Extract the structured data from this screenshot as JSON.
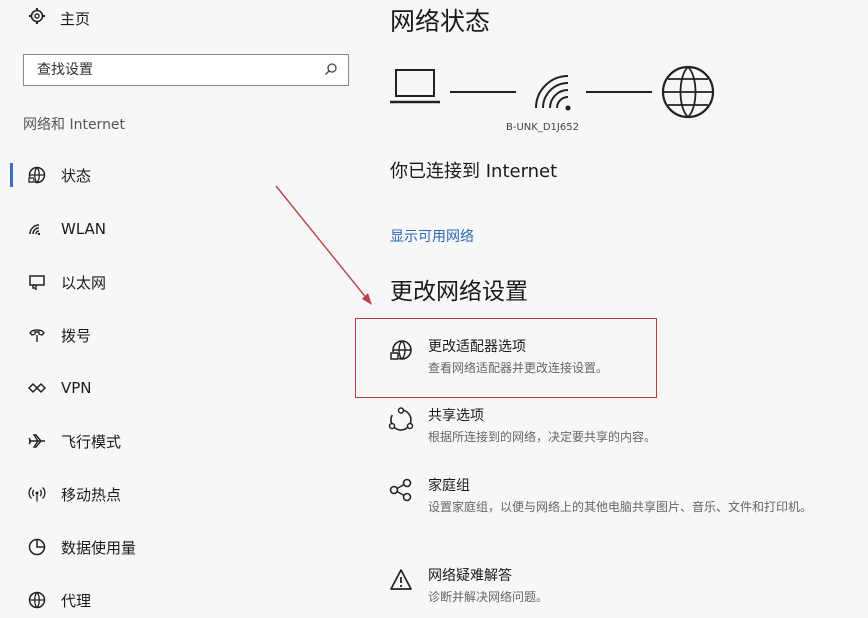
{
  "sidebar": {
    "home_label": "主页",
    "search_placeholder": "查找设置",
    "section_label": "网络和 Internet",
    "items": [
      {
        "label": "状态",
        "icon": "status-globe-icon"
      },
      {
        "label": "WLAN",
        "icon": "wifi-icon"
      },
      {
        "label": "以太网",
        "icon": "ethernet-icon"
      },
      {
        "label": "拨号",
        "icon": "dialup-icon"
      },
      {
        "label": "VPN",
        "icon": "vpn-icon"
      },
      {
        "label": "飞行模式",
        "icon": "airplane-icon"
      },
      {
        "label": "移动热点",
        "icon": "hotspot-icon"
      },
      {
        "label": "数据使用量",
        "icon": "data-usage-icon"
      },
      {
        "label": "代理",
        "icon": "proxy-globe-icon"
      }
    ],
    "active_index": 0
  },
  "main": {
    "title": "网络状态",
    "network_name": "B-UNK_D1J652",
    "connected_text": "你已连接到 Internet",
    "show_networks_link": "显示可用网络",
    "change_title": "更改网络设置",
    "options": [
      {
        "title": "更改适配器选项",
        "desc": "查看网络适配器并更改连接设置。",
        "icon": "adapter-globe-icon"
      },
      {
        "title": "共享选项",
        "desc": "根据所连接到的网络，决定要共享的内容。",
        "icon": "sharing-icon"
      },
      {
        "title": "家庭组",
        "desc": "设置家庭组，以便与网络上的其他电脑共享图片、音乐、文件和打印机。",
        "icon": "homegroup-icon"
      },
      {
        "title": "网络疑难解答",
        "desc": "诊断并解决网络问题。",
        "icon": "warning-icon"
      }
    ]
  },
  "colors": {
    "accent": "#3a6fc4",
    "link": "#2a68b6",
    "highlight": "#c0393b"
  }
}
